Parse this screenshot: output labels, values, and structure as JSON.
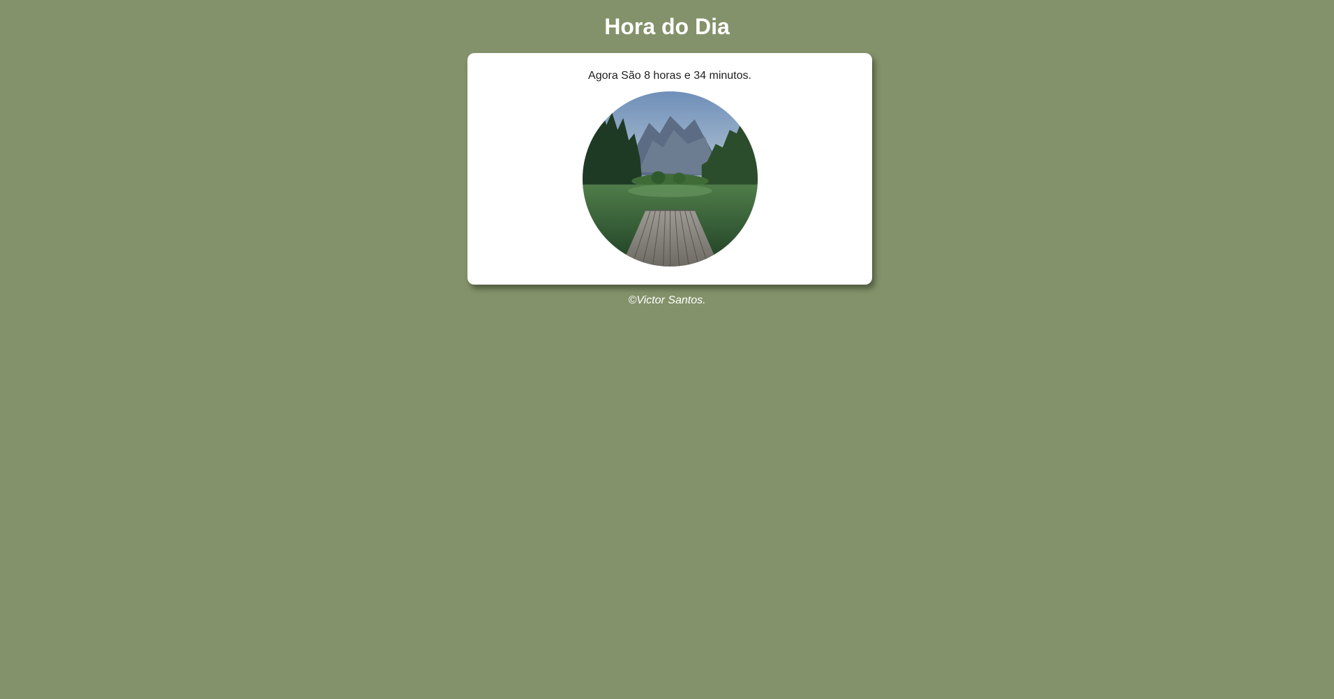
{
  "header": {
    "title": "Hora do Dia"
  },
  "main": {
    "time_message": "Agora São 8 horas e 34 minutos.",
    "image": {
      "icon": "lake-pier-landscape-photo",
      "shape": "circle"
    }
  },
  "footer": {
    "copyright": "©Victor Santos."
  },
  "colors": {
    "background": "#83926a",
    "card": "#ffffff",
    "title_text": "#ffffff",
    "body_text": "#1e1e1e"
  }
}
